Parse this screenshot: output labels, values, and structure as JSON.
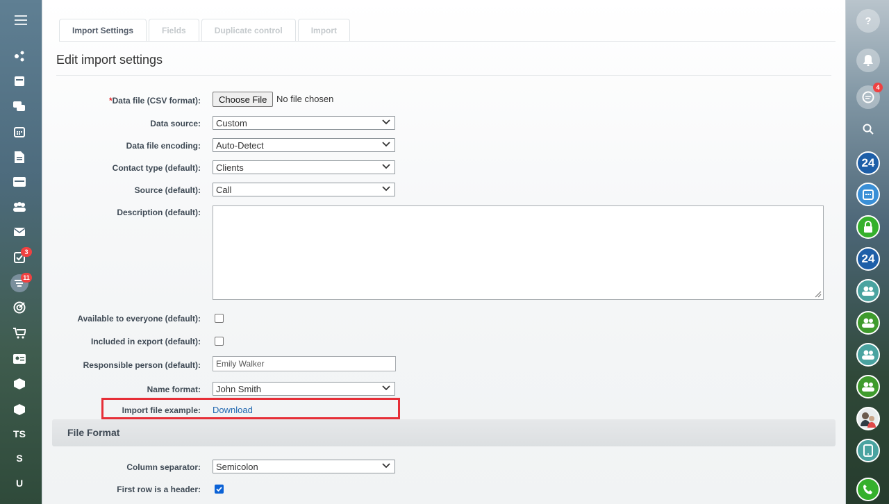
{
  "tabs": [
    {
      "label": "Import Settings",
      "active": true
    },
    {
      "label": "Fields",
      "active": false
    },
    {
      "label": "Duplicate control",
      "active": false
    },
    {
      "label": "Import",
      "active": false
    }
  ],
  "page_title": "Edit import settings",
  "form": {
    "data_file": {
      "required_mark": "*",
      "label": "Data file (CSV format):",
      "button": "Choose File",
      "status": "No file chosen"
    },
    "data_source": {
      "label": "Data source:",
      "value": "Custom"
    },
    "encoding": {
      "label": "Data file encoding:",
      "value": "Auto-Detect"
    },
    "contact_type": {
      "label": "Contact type (default):",
      "value": "Clients"
    },
    "source": {
      "label": "Source (default):",
      "value": "Call"
    },
    "description": {
      "label": "Description (default):",
      "value": ""
    },
    "available": {
      "label": "Available to everyone (default):",
      "checked": false
    },
    "included_export": {
      "label": "Included in export (default):",
      "checked": false
    },
    "responsible": {
      "label": "Responsible person (default):",
      "value": "Emily Walker"
    },
    "name_format": {
      "label": "Name format:",
      "value": "John Smith"
    },
    "example": {
      "label": "Import file example:",
      "link": "Download"
    }
  },
  "file_format": {
    "title": "File Format",
    "column_separator": {
      "label": "Column separator:",
      "value": "Semicolon"
    },
    "first_row_header": {
      "label": "First row is a header:",
      "checked": true
    }
  },
  "left_sidebar": {
    "items": [
      {
        "icon": "menu-icon"
      },
      {
        "icon": "activity-stream-icon"
      },
      {
        "icon": "calendar-card-icon"
      },
      {
        "icon": "chat-icon"
      },
      {
        "icon": "calendar-icon"
      },
      {
        "icon": "document-icon"
      },
      {
        "icon": "drive-icon"
      },
      {
        "icon": "group-icon"
      },
      {
        "icon": "mail-icon"
      },
      {
        "icon": "tasks-icon",
        "badge": "3"
      },
      {
        "icon": "crm-filter-icon",
        "badge": "11"
      },
      {
        "icon": "target-icon"
      },
      {
        "icon": "cart-icon"
      },
      {
        "icon": "contact-card-icon"
      },
      {
        "icon": "box-icon"
      },
      {
        "icon": "box-icon-2"
      },
      {
        "icon": "ts-text",
        "text": "TS"
      },
      {
        "icon": "s-text",
        "text": "S"
      },
      {
        "icon": "u-text",
        "text": "U"
      }
    ]
  },
  "right_sidebar": {
    "items": [
      {
        "icon": "help-icon"
      },
      {
        "icon": "notification-icon"
      },
      {
        "icon": "messages-icon",
        "badge": "4"
      },
      {
        "icon": "search-icon"
      },
      {
        "icon": "bitrix24-icon",
        "text": "24"
      },
      {
        "icon": "calendar-icon"
      },
      {
        "icon": "lock-icon"
      },
      {
        "icon": "bitrix24-icon-2",
        "text": "24"
      },
      {
        "icon": "group-chat-icon"
      },
      {
        "icon": "group-chat-icon-2"
      },
      {
        "icon": "group-chat-icon-3"
      },
      {
        "icon": "group-chat-icon-4"
      },
      {
        "icon": "user-avatar"
      },
      {
        "icon": "mobile-app-icon"
      },
      {
        "icon": "phone-icon"
      }
    ]
  },
  "colors": {
    "accent": "#2067b0",
    "highlight": "#e62e37",
    "badge": "#f04141",
    "green": "#35b02c",
    "blue": "#1e5fa8"
  }
}
